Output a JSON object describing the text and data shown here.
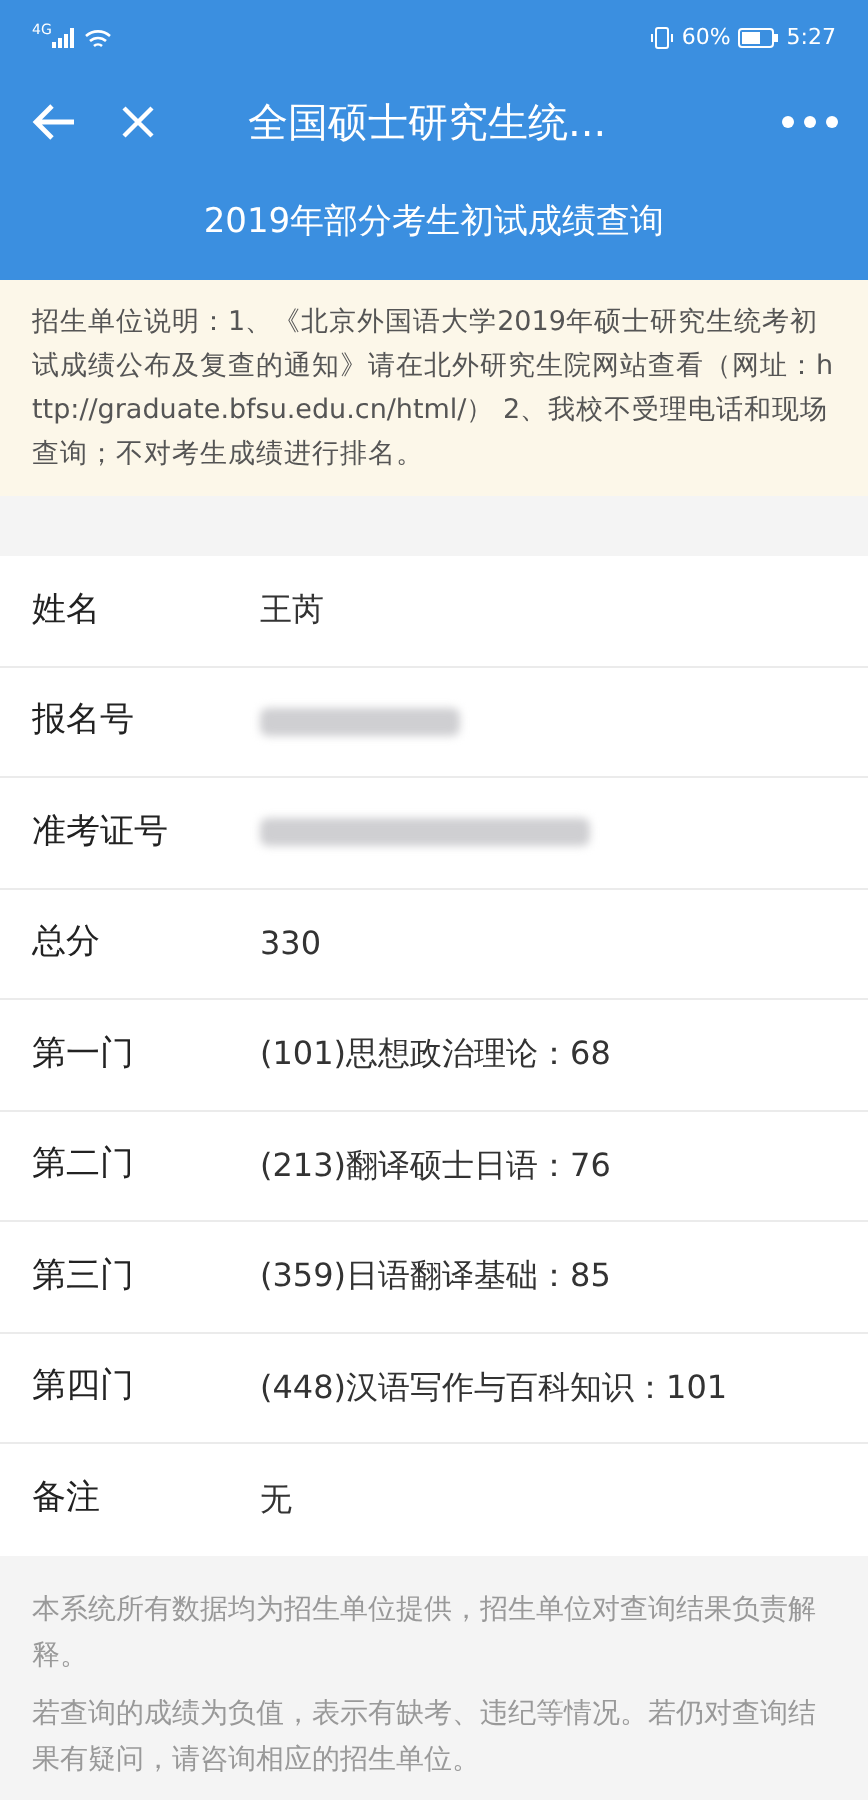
{
  "status_bar": {
    "battery": "60%",
    "time": "5:27",
    "network": "4G"
  },
  "nav": {
    "title": "全国硕士研究生统..."
  },
  "page_title": "2019年部分考生初试成绩查询",
  "notice": "招生单位说明：1、《北京外国语大学2019年硕士研究生统考初试成绩公布及复查的通知》请在北外研究生院网站查看（网址：http://graduate.bfsu.edu.cn/html/） 2、我校不受理电话和现场查询；不对考生成绩进行排名。",
  "rows": [
    {
      "label": "姓名",
      "kind": "text",
      "value": "王芮"
    },
    {
      "label": "报名号",
      "kind": "redacted"
    },
    {
      "label": "准考证号",
      "kind": "redacted"
    },
    {
      "label": "总分",
      "kind": "text",
      "value": "330"
    },
    {
      "label": "第一门",
      "kind": "text",
      "value": "(101)思想政治理论：68"
    },
    {
      "label": "第二门",
      "kind": "text",
      "value": "(213)翻译硕士日语：76"
    },
    {
      "label": "第三门",
      "kind": "text",
      "value": "(359)日语翻译基础：85"
    },
    {
      "label": "第四门",
      "kind": "text",
      "value": "(448)汉语写作与百科知识：101"
    },
    {
      "label": "备注",
      "kind": "text",
      "value": "无"
    }
  ],
  "footer": [
    "本系统所有数据均为招生单位提供，招生单位对查询结果负责解释。",
    "若查询的成绩为负值，表示有缺考、违纪等情况。若仍对查询结果有疑问，请咨询相应的招生单位。"
  ]
}
